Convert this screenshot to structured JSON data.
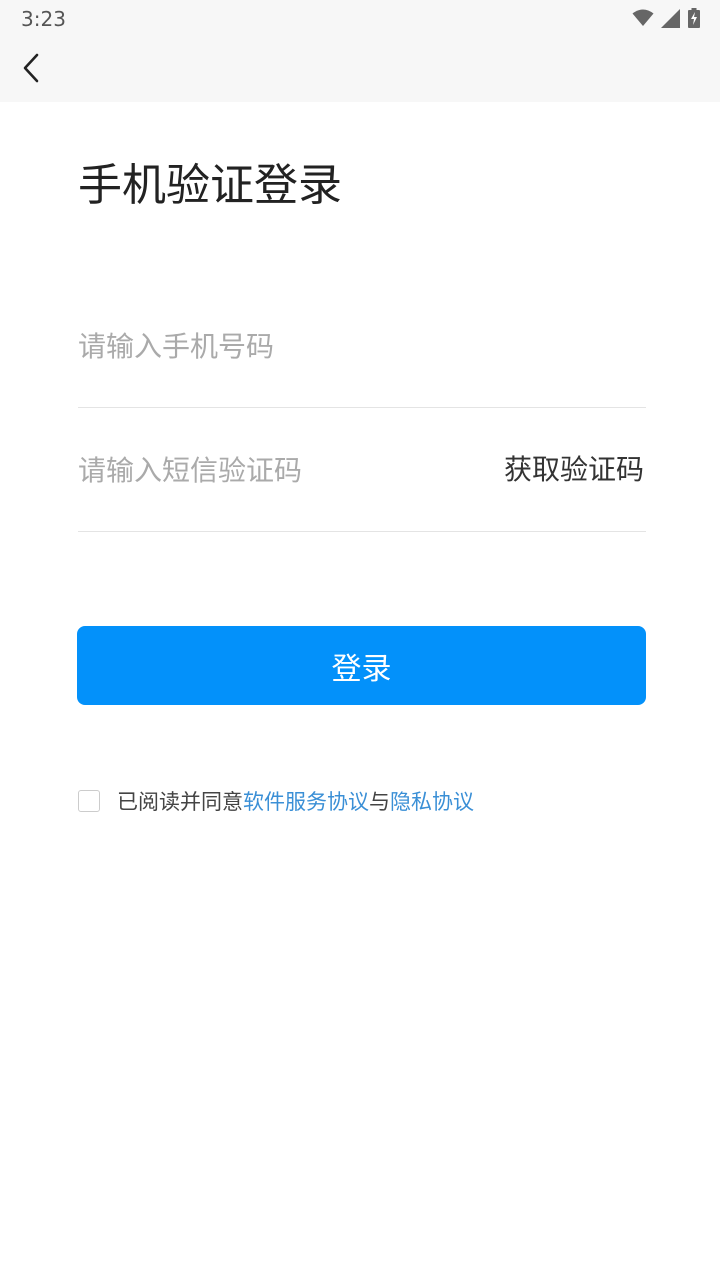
{
  "status_bar": {
    "time": "3:23",
    "icons": [
      "wifi-icon",
      "cellular-signal-icon",
      "battery-charging-icon"
    ]
  },
  "nav": {
    "back_icon": "chevron-left-icon"
  },
  "page": {
    "title": "手机验证登录"
  },
  "form": {
    "phone_placeholder": "请输入手机号码",
    "phone_value": "",
    "code_placeholder": "请输入短信验证码",
    "code_value": "",
    "get_code_label": "获取验证码",
    "login_label": "登录"
  },
  "agreement": {
    "checked": false,
    "prefix": "已阅读并同意",
    "service_link": "软件服务协议",
    "conjunction": "与",
    "privacy_link": "隐私协议"
  },
  "colors": {
    "accent": "#0391fa",
    "link": "#3a8fd6",
    "status_bar_bg": "#f7f7f7"
  }
}
